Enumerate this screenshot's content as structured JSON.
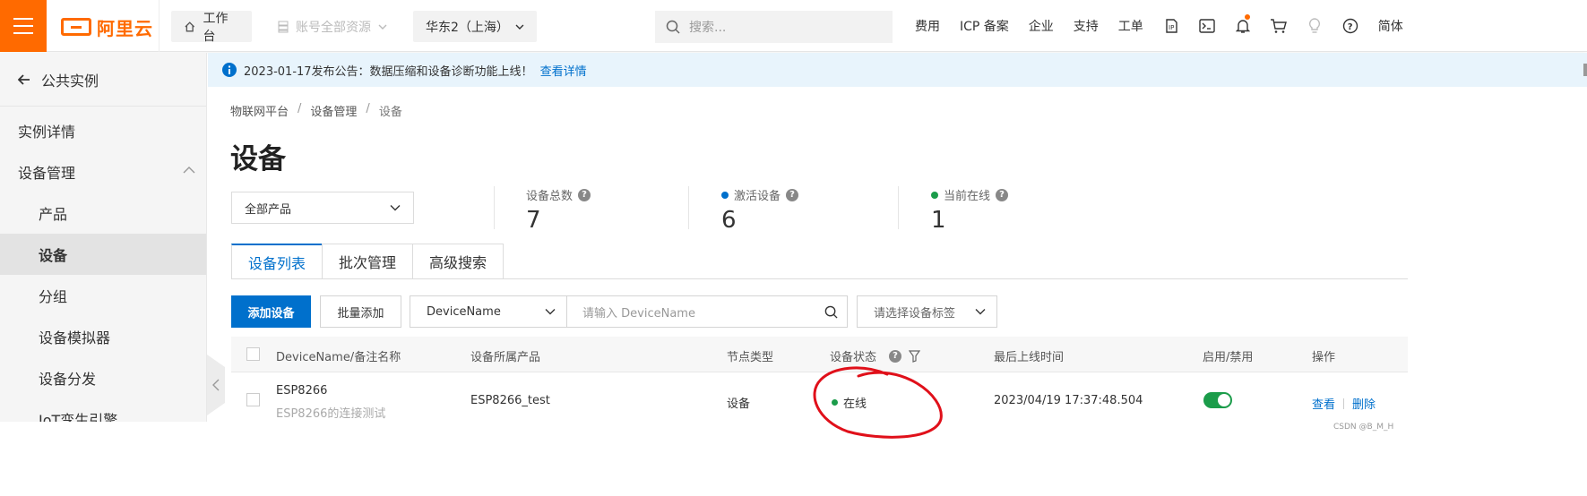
{
  "topbar": {
    "logo_text": "阿里云",
    "workbench": "工作台",
    "account_resources": "账号全部资源",
    "region": "华东2（上海）",
    "search_placeholder": "搜索...",
    "links": [
      "费用",
      "ICP 备案",
      "企业",
      "支持",
      "工单"
    ],
    "lang": "简体",
    "brand_color": "#ff6a00"
  },
  "sidebar": {
    "back_label": "公共实例",
    "items": [
      {
        "label": "实例详情"
      },
      {
        "label": "设备管理"
      },
      {
        "label": "产品"
      },
      {
        "label": "设备"
      },
      {
        "label": "分组"
      },
      {
        "label": "设备模拟器"
      },
      {
        "label": "设备分发"
      },
      {
        "label": "IoT孪生引擎"
      }
    ]
  },
  "notice": {
    "text": "2023-01-17发布公告：数据压缩和设备诊断功能上线！",
    "link": "查看详情"
  },
  "breadcrumb": [
    "物联网平台",
    "设备管理",
    "设备"
  ],
  "page_title": "设备",
  "product_select": "全部产品",
  "stats": [
    {
      "label": "设备总数",
      "value": "7"
    },
    {
      "label": "激活设备",
      "value": "6",
      "dot_color": "#0070cc"
    },
    {
      "label": "当前在线",
      "value": "1",
      "dot_color": "#1b9c4a"
    }
  ],
  "tabs": [
    "设备列表",
    "批次管理",
    "高级搜索"
  ],
  "toolbar": {
    "add_device": "添加设备",
    "batch_add": "批量添加",
    "field_select": "DeviceName",
    "search_placeholder": "请输入 DeviceName",
    "tag_select": "请选择设备标签"
  },
  "table": {
    "headers": [
      "DeviceName/备注名称",
      "设备所属产品",
      "节点类型",
      "设备状态",
      "最后上线时间",
      "启用/禁用",
      "操作"
    ],
    "rows": [
      {
        "device_name": "ESP8266",
        "remark": "ESP8266的连接测试",
        "product": "ESP8266_test",
        "node_type": "设备",
        "status": "在线",
        "last_online": "2023/04/19 17:37:48.504",
        "enabled": true,
        "action_view": "查看",
        "action_delete": "删除"
      }
    ]
  },
  "watermark": "CSDN @B_M_H"
}
